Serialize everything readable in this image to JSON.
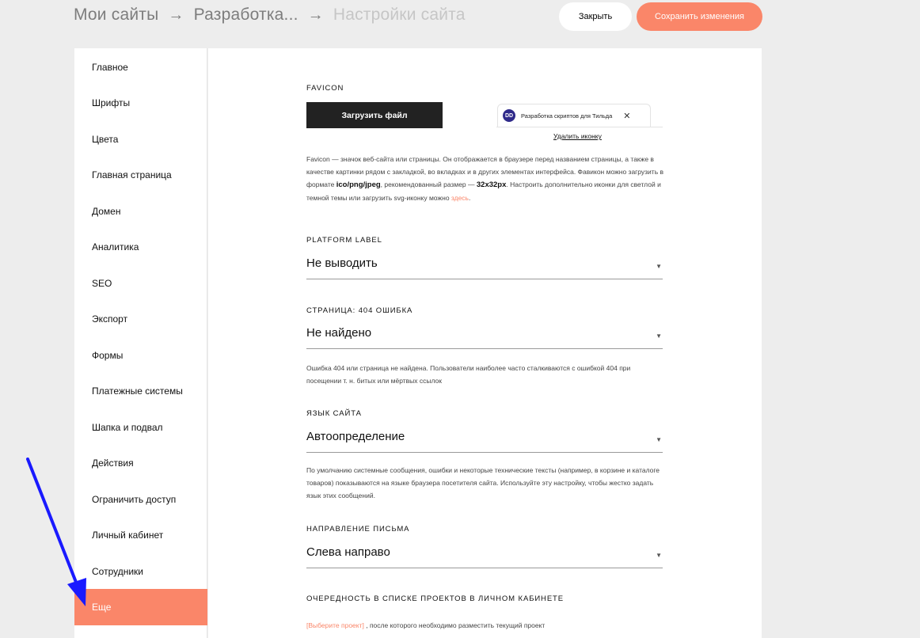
{
  "breadcrumb": {
    "item1": "Мои сайты",
    "sep1": "→",
    "item2": "Разработка...",
    "sep2": "→",
    "item3": "Настройки сайта"
  },
  "header": {
    "close_label": "Закрыть",
    "save_label": "Сохранить изменения"
  },
  "colors": {
    "accent": "#fa8669",
    "dark_button": "#222222",
    "annotation_arrow": "#1a1aff"
  },
  "sidebar": {
    "items": [
      {
        "label": "Главное"
      },
      {
        "label": "Шрифты"
      },
      {
        "label": "Цвета"
      },
      {
        "label": "Главная страница"
      },
      {
        "label": "Домен"
      },
      {
        "label": "Аналитика"
      },
      {
        "label": "SEO"
      },
      {
        "label": "Экспорт"
      },
      {
        "label": "Формы"
      },
      {
        "label": "Платежные системы"
      },
      {
        "label": "Шапка и подвал"
      },
      {
        "label": "Действия"
      },
      {
        "label": "Ограничить доступ"
      },
      {
        "label": "Личный кабинет"
      },
      {
        "label": "Сотрудники"
      },
      {
        "label": "Еще",
        "active": true
      }
    ]
  },
  "favicon": {
    "title": "FAVICON",
    "upload_label": "Загрузить файл",
    "tab_icon_text": "DD",
    "tab_title": "Разработка скриптов для Тильда",
    "tab_close": "✕",
    "remove_label": "Удалить иконку",
    "desc_part1": "Favicon — значок веб-сайта или страницы. Он отображается в браузере перед названием страницы, а также в качестве картинки рядом с закладкой, во вкладках и в других элементах интерфейса. Фавикон можно загрузить в формате ",
    "desc_format": "ico/png/jpeg",
    "desc_part2": ", рекомендованный размер — ",
    "desc_size": "32x32px",
    "desc_part3": ". Настроить дополнительно иконки для светлой и темной темы или загрузить svg-иконку можно ",
    "desc_link": "здесь",
    "desc_end": "."
  },
  "platform_label": {
    "title": "PLATFORM LABEL",
    "value": "Не выводить"
  },
  "page_404": {
    "title": "СТРАНИЦА: 404 ОШИБКА",
    "value": "Не найдено",
    "desc": "Ошибка 404 или страница не найдена. Пользователи наиболее часто сталкиваются с ошибкой 404 при посещении т. н. битых или мёртвых ссылок"
  },
  "site_language": {
    "title": "ЯЗЫК САЙТА",
    "value": "Автоопределение",
    "desc": "По умолчанию системные сообщения, ошибки и некоторые технические тексты (например, в корзине и каталоге товаров) показываются на языке браузера посетителя сайта. Используйте эту настройку, чтобы жестко задать язык этих сообщений."
  },
  "writing_direction": {
    "title": "НАПРАВЛЕНИЕ ПИСЬМА",
    "value": "Слева направо"
  },
  "project_order": {
    "title": "ОЧЕРЕДНОСТЬ В СПИСКЕ ПРОЕКТОВ В ЛИЧНОМ КАБИНЕТЕ",
    "link": "[Выберите проект]",
    "text": " , после которого необходимо разместить текущий проект"
  },
  "select_arrow": "▼"
}
